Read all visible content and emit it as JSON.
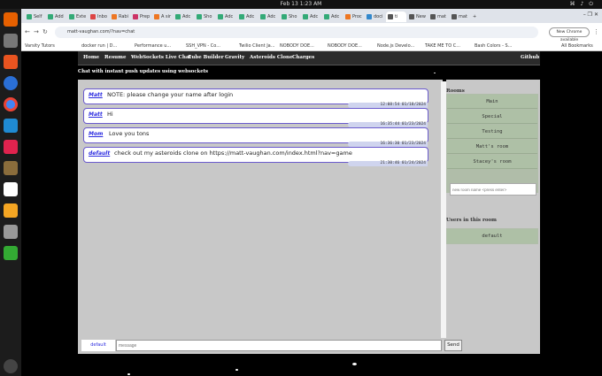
{
  "os": {
    "clock": "Feb 13  1:23 AM",
    "tray": "⌘ ♪ ⏻"
  },
  "browser": {
    "tabs": [
      {
        "label": "Self",
        "color": "#3a7"
      },
      {
        "label": "Add",
        "color": "#3a7"
      },
      {
        "label": "Exte",
        "color": "#3a7"
      },
      {
        "label": "Inbo",
        "color": "#d44"
      },
      {
        "label": "Rabi",
        "color": "#e72"
      },
      {
        "label": "Prep",
        "color": "#c36"
      },
      {
        "label": "A sir",
        "color": "#e72"
      },
      {
        "label": "Adc",
        "color": "#3a7"
      },
      {
        "label": "Sho",
        "color": "#3a7"
      },
      {
        "label": "Adc",
        "color": "#3a7"
      },
      {
        "label": "Adc",
        "color": "#3a7"
      },
      {
        "label": "Adc",
        "color": "#3a7"
      },
      {
        "label": "Sho",
        "color": "#3a7"
      },
      {
        "label": "Adc",
        "color": "#3a7"
      },
      {
        "label": "Adc",
        "color": "#3a7"
      },
      {
        "label": "Proc",
        "color": "#e72"
      },
      {
        "label": "doci",
        "color": "#38c"
      },
      {
        "label": "ti",
        "color": "#555"
      },
      {
        "label": "New",
        "color": "#555"
      },
      {
        "label": "mat",
        "color": "#555"
      },
      {
        "label": "mat",
        "color": "#555"
      }
    ],
    "url": "matt-vaughan.com/?nav=chat",
    "update_label": "New Chrome available",
    "bookmarks": [
      "Varsity Tutors",
      "docker run | D...",
      "Performance u...",
      "SSH_VPN - Co...",
      "Twilio Client Ja...",
      "NOBODY DOE...",
      "NOBODY DOE...",
      "Node.js Develo...",
      "TAKE ME TO C...",
      "Bash Colors - S..."
    ],
    "all_bookmarks": "All Bookmarks"
  },
  "site": {
    "nav": [
      "Home",
      "Resume",
      "WebSockets Live Chat",
      "Cube Builder",
      "Gravity",
      "Asteroids Clone",
      "Charges"
    ],
    "github": "Github",
    "tagline": "Chat with instant push updates using websockets",
    "messages": [
      {
        "user": "Matt",
        "text": "NOTE: please change your name after login",
        "time": "12:08:54 01/18/2024"
      },
      {
        "user": "Matt",
        "text": "Hi",
        "time": "16:35:44 01/23/2024"
      },
      {
        "user": "Mom",
        "text": "Love you tons",
        "time": "16:36:30 01/23/2024"
      },
      {
        "user": "default",
        "text": "check out my asteroids clone on https://matt-vaughan.com/index.html?nav=game",
        "time": "21:30:46 01/24/2024"
      }
    ],
    "rooms_title": "Rooms",
    "rooms": [
      "Main",
      "Special",
      "Testing",
      "Matt's room",
      "Stacey's room"
    ],
    "new_room_placeholder": "new room name <press enter>",
    "users_title": "Users in this room",
    "users": [
      "default"
    ],
    "current_user": "default",
    "message_placeholder": "message",
    "send_label": "Send"
  }
}
